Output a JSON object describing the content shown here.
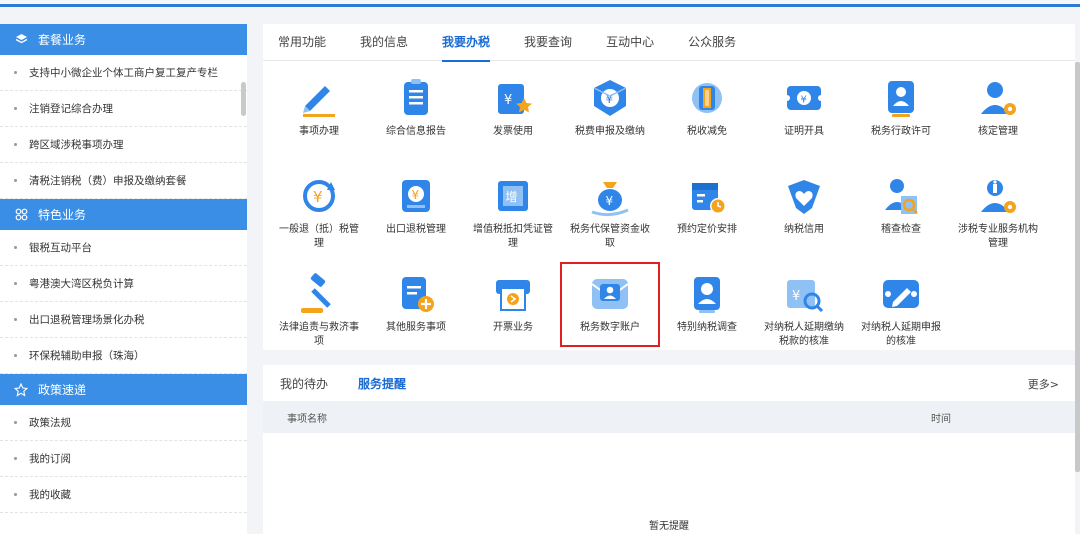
{
  "sidebar": {
    "sections": [
      {
        "title": "套餐业务",
        "icon": "layers-icon",
        "items": [
          "支持中小微企业个体工商户复工复产专栏",
          "注销登记综合办理",
          "跨区域涉税事项办理",
          "清税注销税（费）申报及缴纳套餐"
        ]
      },
      {
        "title": "特色业务",
        "icon": "grid-icon",
        "items": [
          "银税互动平台",
          "粤港澳大湾区税负计算",
          "出口退税管理场景化办税",
          "环保税辅助申报（珠海）"
        ]
      },
      {
        "title": "政策速递",
        "icon": "star-icon",
        "items": [
          "政策法规",
          "我的订阅",
          "我的收藏"
        ]
      }
    ]
  },
  "main": {
    "tabs": [
      "常用功能",
      "我的信息",
      "我要办税",
      "我要查询",
      "互动中心",
      "公众服务"
    ],
    "active_tab": "我要办税",
    "functions": [
      {
        "label": "事项办理",
        "icon": "pen-icon"
      },
      {
        "label": "综合信息报告",
        "icon": "report-icon"
      },
      {
        "label": "发票使用",
        "icon": "invoice-icon"
      },
      {
        "label": "税费申报及缴纳",
        "icon": "tax-payment-icon"
      },
      {
        "label": "税收减免",
        "icon": "coins-icon"
      },
      {
        "label": "证明开具",
        "icon": "certificate-icon"
      },
      {
        "label": "税务行政许可",
        "icon": "person-card-icon"
      },
      {
        "label": "核定管理",
        "icon": "user-gear-icon"
      },
      {
        "label": "一般退（抵）税管理",
        "icon": "refund-icon"
      },
      {
        "label": "出口退税管理",
        "icon": "export-refund-icon"
      },
      {
        "label": "增值税抵扣凭证管理",
        "icon": "vat-ticket-icon"
      },
      {
        "label": "税务代保管资金收取",
        "icon": "money-bag-icon"
      },
      {
        "label": "预约定价安排",
        "icon": "calendar-clock-icon"
      },
      {
        "label": "纳税信用",
        "icon": "heart-shield-icon"
      },
      {
        "label": "稽查检查",
        "icon": "inspect-icon"
      },
      {
        "label": "涉税专业服务机构管理",
        "icon": "agency-gear-icon"
      },
      {
        "label": "法律追责与救济事项",
        "icon": "gavel-icon"
      },
      {
        "label": "其他服务事项",
        "icon": "doc-plus-icon"
      },
      {
        "label": "开票业务",
        "icon": "printer-icon"
      },
      {
        "label": "税务数字账户",
        "icon": "digital-account-icon"
      },
      {
        "label": "特别纳税调查",
        "icon": "person-badge-icon"
      },
      {
        "label": "对纳税人延期缴纳税款的核准",
        "icon": "money-search-icon"
      },
      {
        "label": "对纳税人延期申报的核准",
        "icon": "edit-icon"
      }
    ],
    "highlighted": "税务数字账户"
  },
  "reminders": {
    "tabs": [
      "我的待办",
      "服务提醒"
    ],
    "active_tab": "服务提醒",
    "more": "更多>",
    "col_name": "事项名称",
    "col_time": "时间",
    "empty": "暂无提醒"
  },
  "colors": {
    "accent": "#3a8ee6",
    "active_tab": "#1a6bd3",
    "highlight_border": "#e02020",
    "icon_blue": "#2f86e8",
    "icon_orange": "#f4a31c"
  }
}
